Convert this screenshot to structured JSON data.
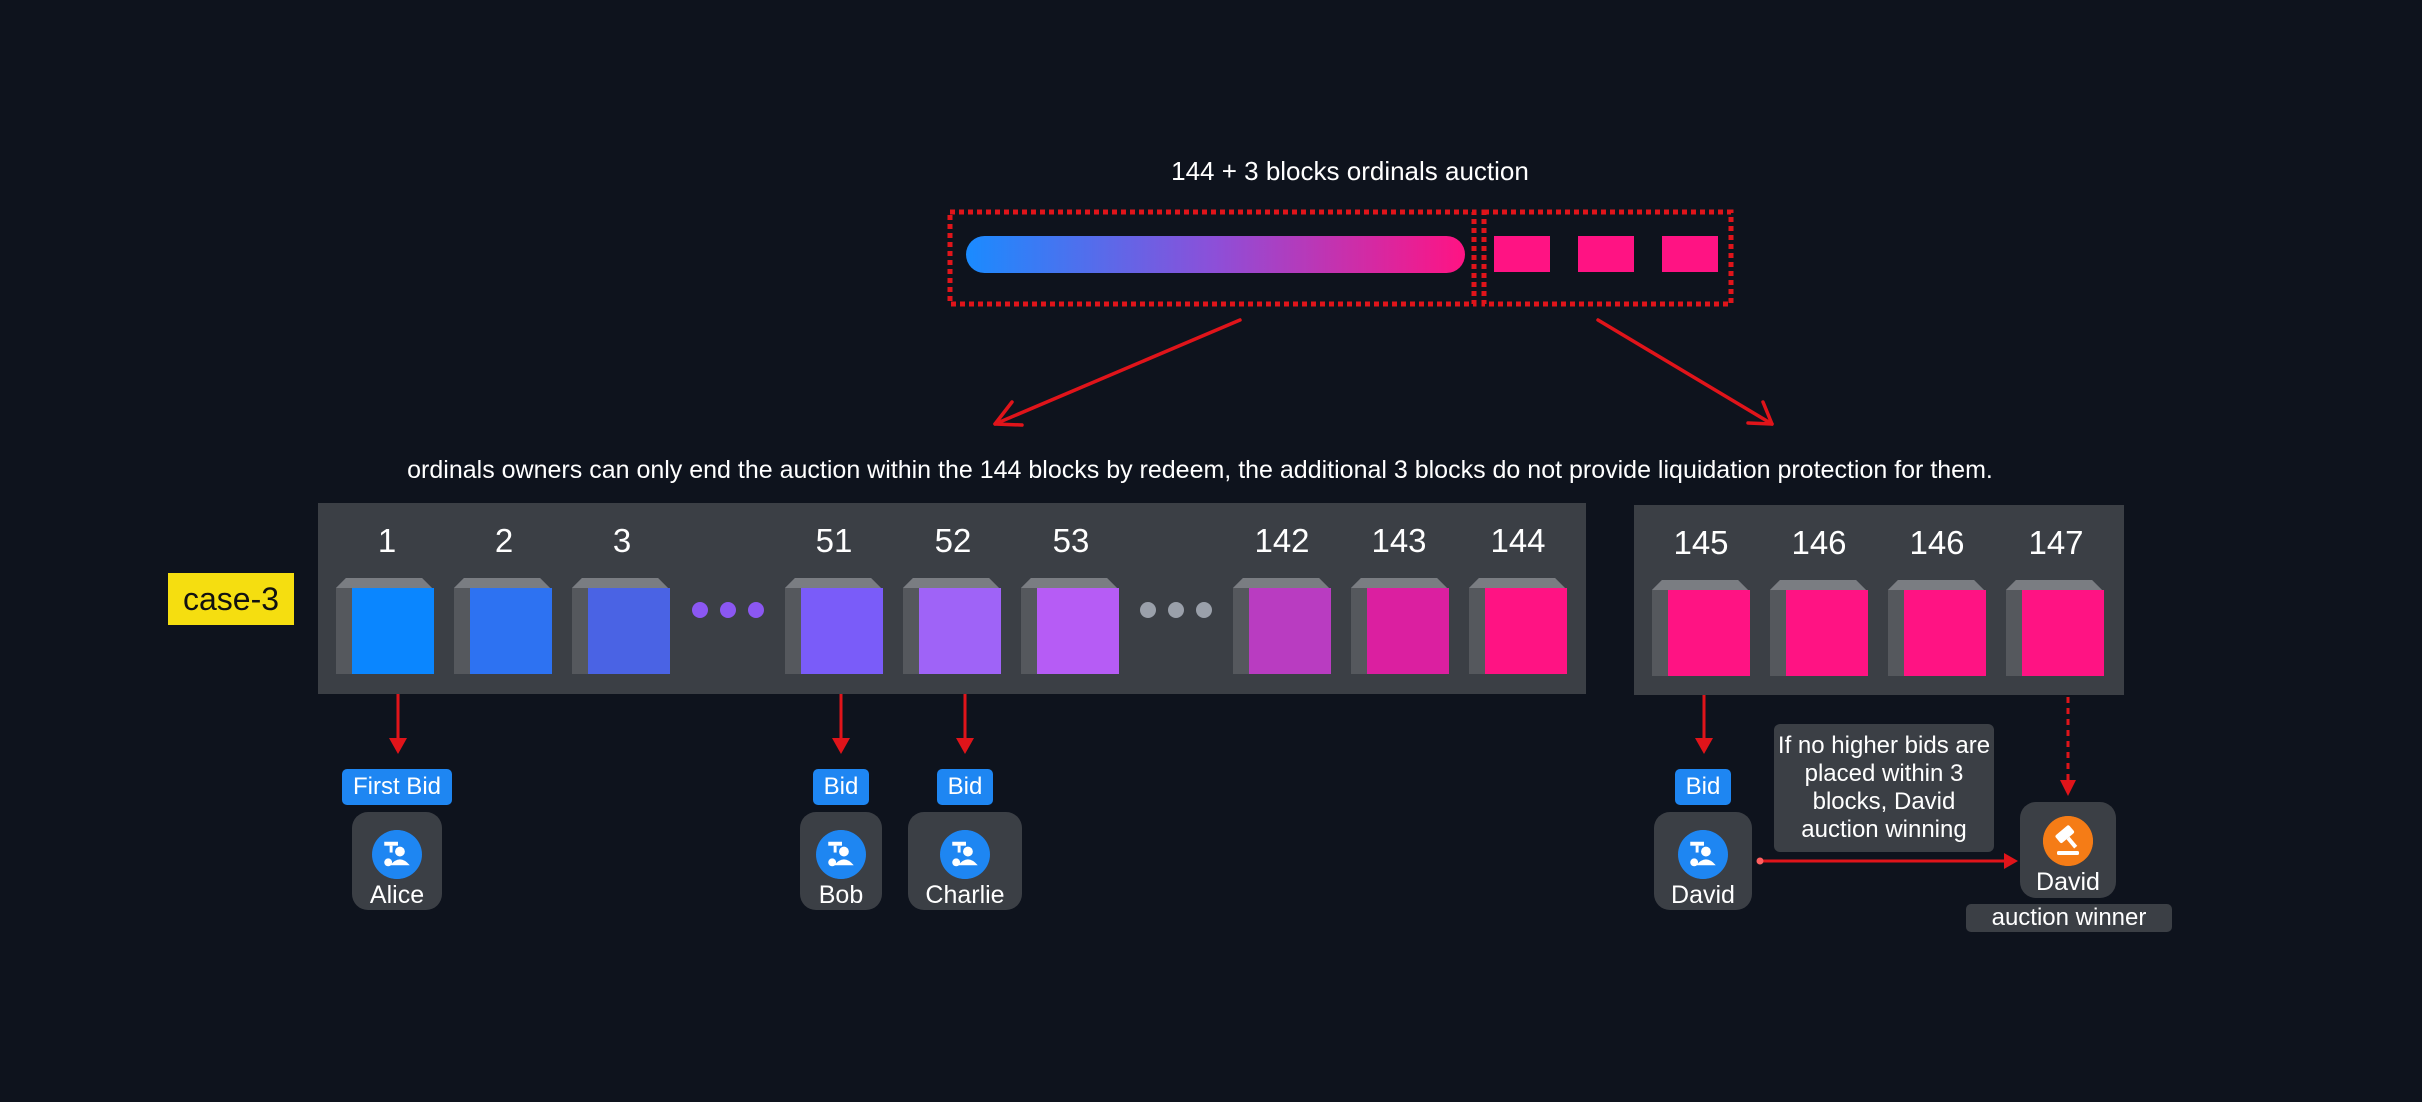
{
  "title": "144 + 3 blocks ordinals auction",
  "caption": "ordinals owners can only end the auction within the 144 blocks by redeem,  the additional 3 blocks do not provide liquidation protection for them.",
  "case_label": "case-3",
  "main_blocks": [
    "1",
    "2",
    "3",
    "51",
    "52",
    "53",
    "142",
    "143",
    "144"
  ],
  "extra_blocks": [
    "145",
    "146",
    "146",
    "147"
  ],
  "colors": {
    "cube_main": [
      "#0a86ff",
      "#2d72f2",
      "#4a63e4",
      "#7a5cf9",
      "#9f63f7",
      "#b65cf5",
      "#b93cc1",
      "#db1fa0",
      "#ff1383"
    ],
    "cube_extra": "#ff1383",
    "dots_left": "#8b57f2",
    "dots_right": "#9aa0aa",
    "arrow": "#e0141a",
    "bid_tag": "#1e86f2",
    "winner_icon": "#f57c16"
  },
  "bids": {
    "alice_tag": "First Bid",
    "alice_name": "Alice",
    "bob_tag": "Bid",
    "bob_name": "Bob",
    "charlie_tag": "Bid",
    "charlie_name": "Charlie",
    "david_tag": "Bid",
    "david_name": "David"
  },
  "note": "If no higher bids are placed within 3 blocks, David auction winning",
  "winner": {
    "name": "David",
    "label": "auction winner"
  },
  "icons": {
    "bidder": "user-icon",
    "winner": "gavel-icon"
  }
}
